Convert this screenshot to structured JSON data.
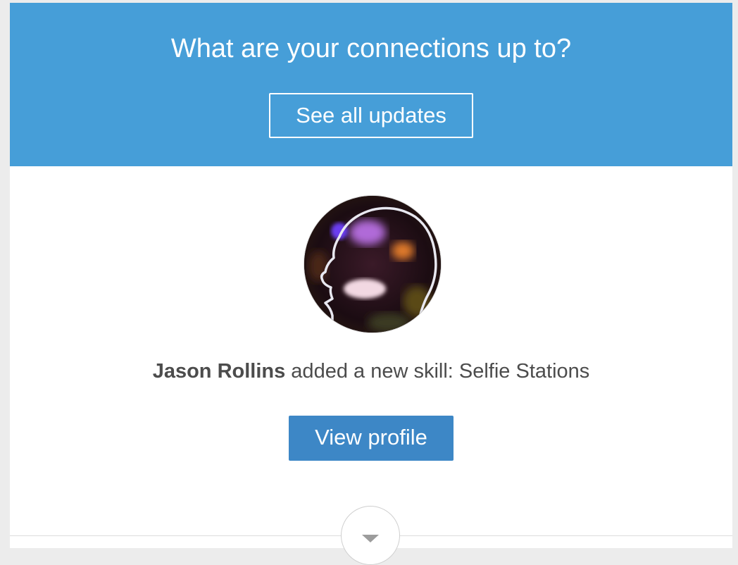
{
  "banner": {
    "title": "What are your connections up to?",
    "button_label": "See all updates",
    "background_color": "#469ed8"
  },
  "update": {
    "person_name": "Jason Rollins",
    "action_text": " added a new skill: Selfie Stations",
    "avatar_icon": "head-silhouette-icon",
    "view_profile_label": "View profile",
    "button_color": "#3d87c6"
  },
  "footer": {
    "expand_icon": "chevron-down-icon"
  }
}
